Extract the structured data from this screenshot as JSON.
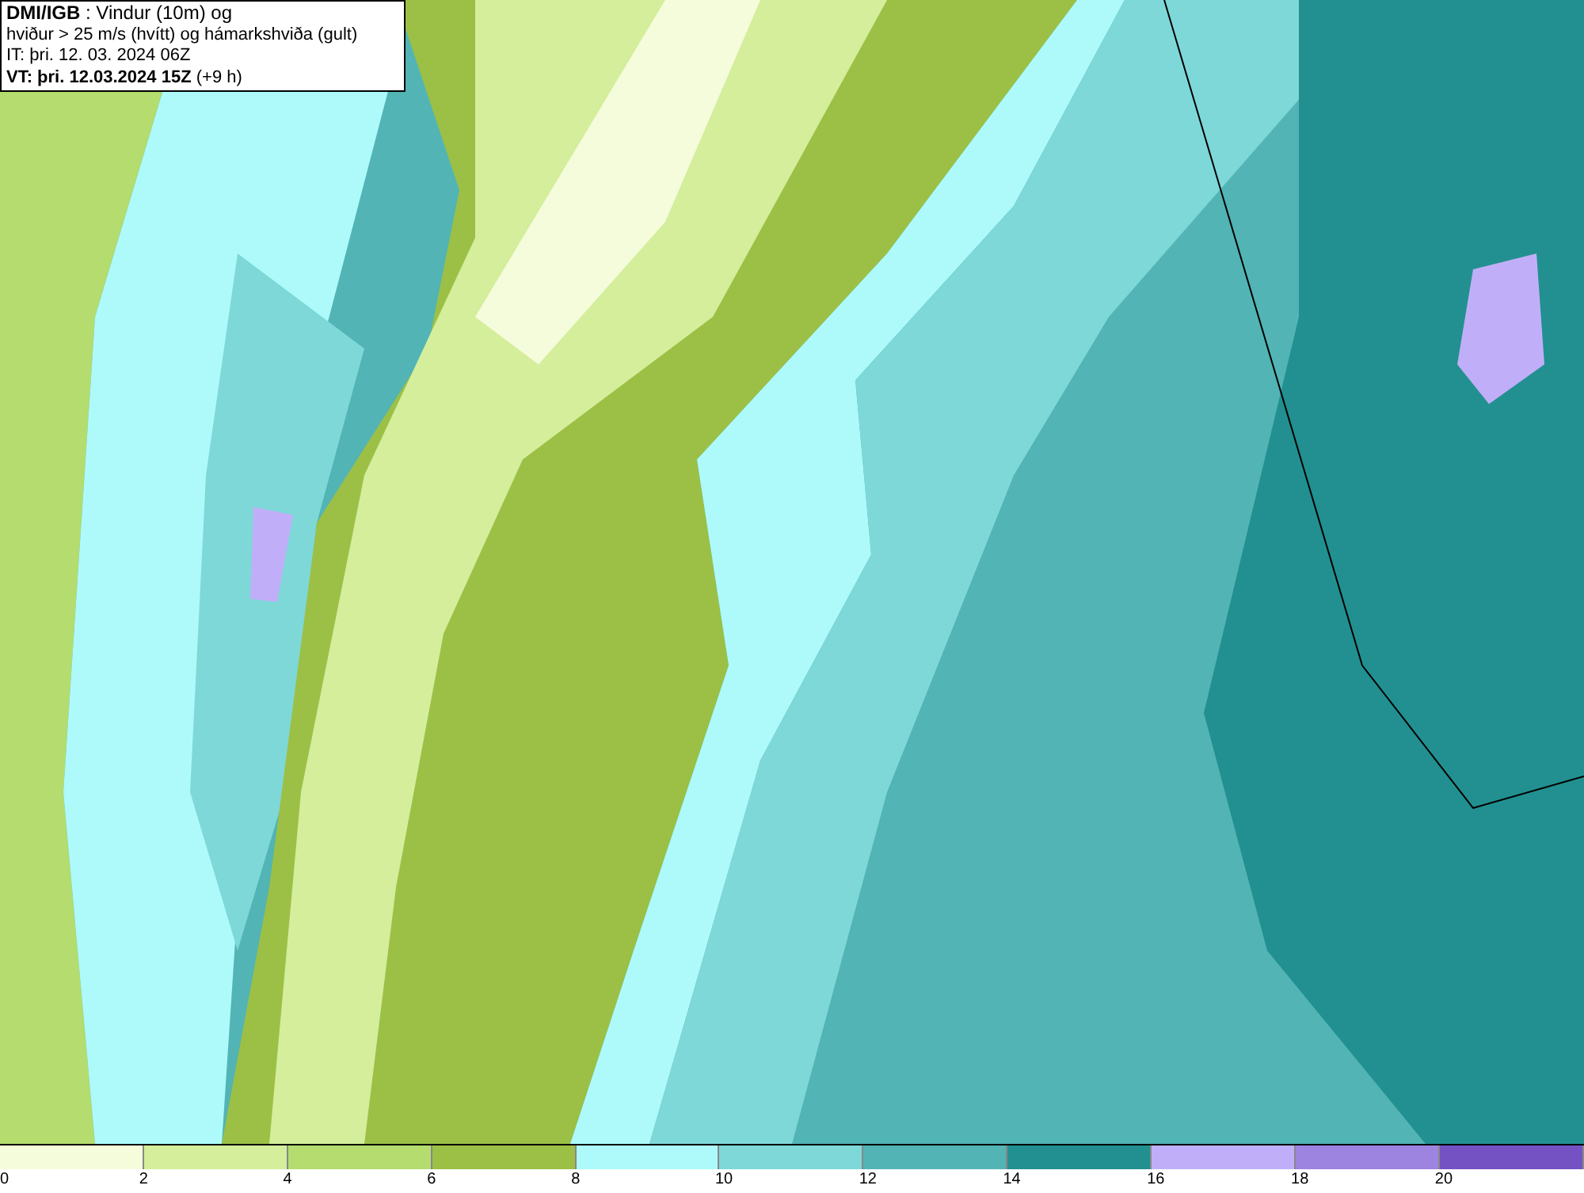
{
  "header": {
    "lines": [
      "**DMI/IGB** : Vindur (10m) og",
      "hviður > 25 m/s (hvítt) og hámarkshviða (gult)",
      "IT: þri. 12. 03. 2024 06Z",
      "**VT: þri. 12.03.2024 15Z** (+9 h)"
    ]
  },
  "legend": {
    "segments": [
      {
        "color": "#f5fcdc"
      },
      {
        "color": "#d4ee9c"
      },
      {
        "color": "#b4dc6e"
      },
      {
        "color": "#9cc046"
      },
      {
        "color": "#aefafa"
      },
      {
        "color": "#7ed8d8"
      },
      {
        "color": "#52b4b4"
      },
      {
        "color": "#229090"
      },
      {
        "color": "#c0aff8"
      },
      {
        "color": "#9c84e0"
      },
      {
        "color": "#7452c4"
      }
    ],
    "labels": [
      "0",
      "2",
      "4",
      "6",
      "8",
      "10",
      "12",
      "14",
      "16",
      "18",
      "20"
    ]
  }
}
